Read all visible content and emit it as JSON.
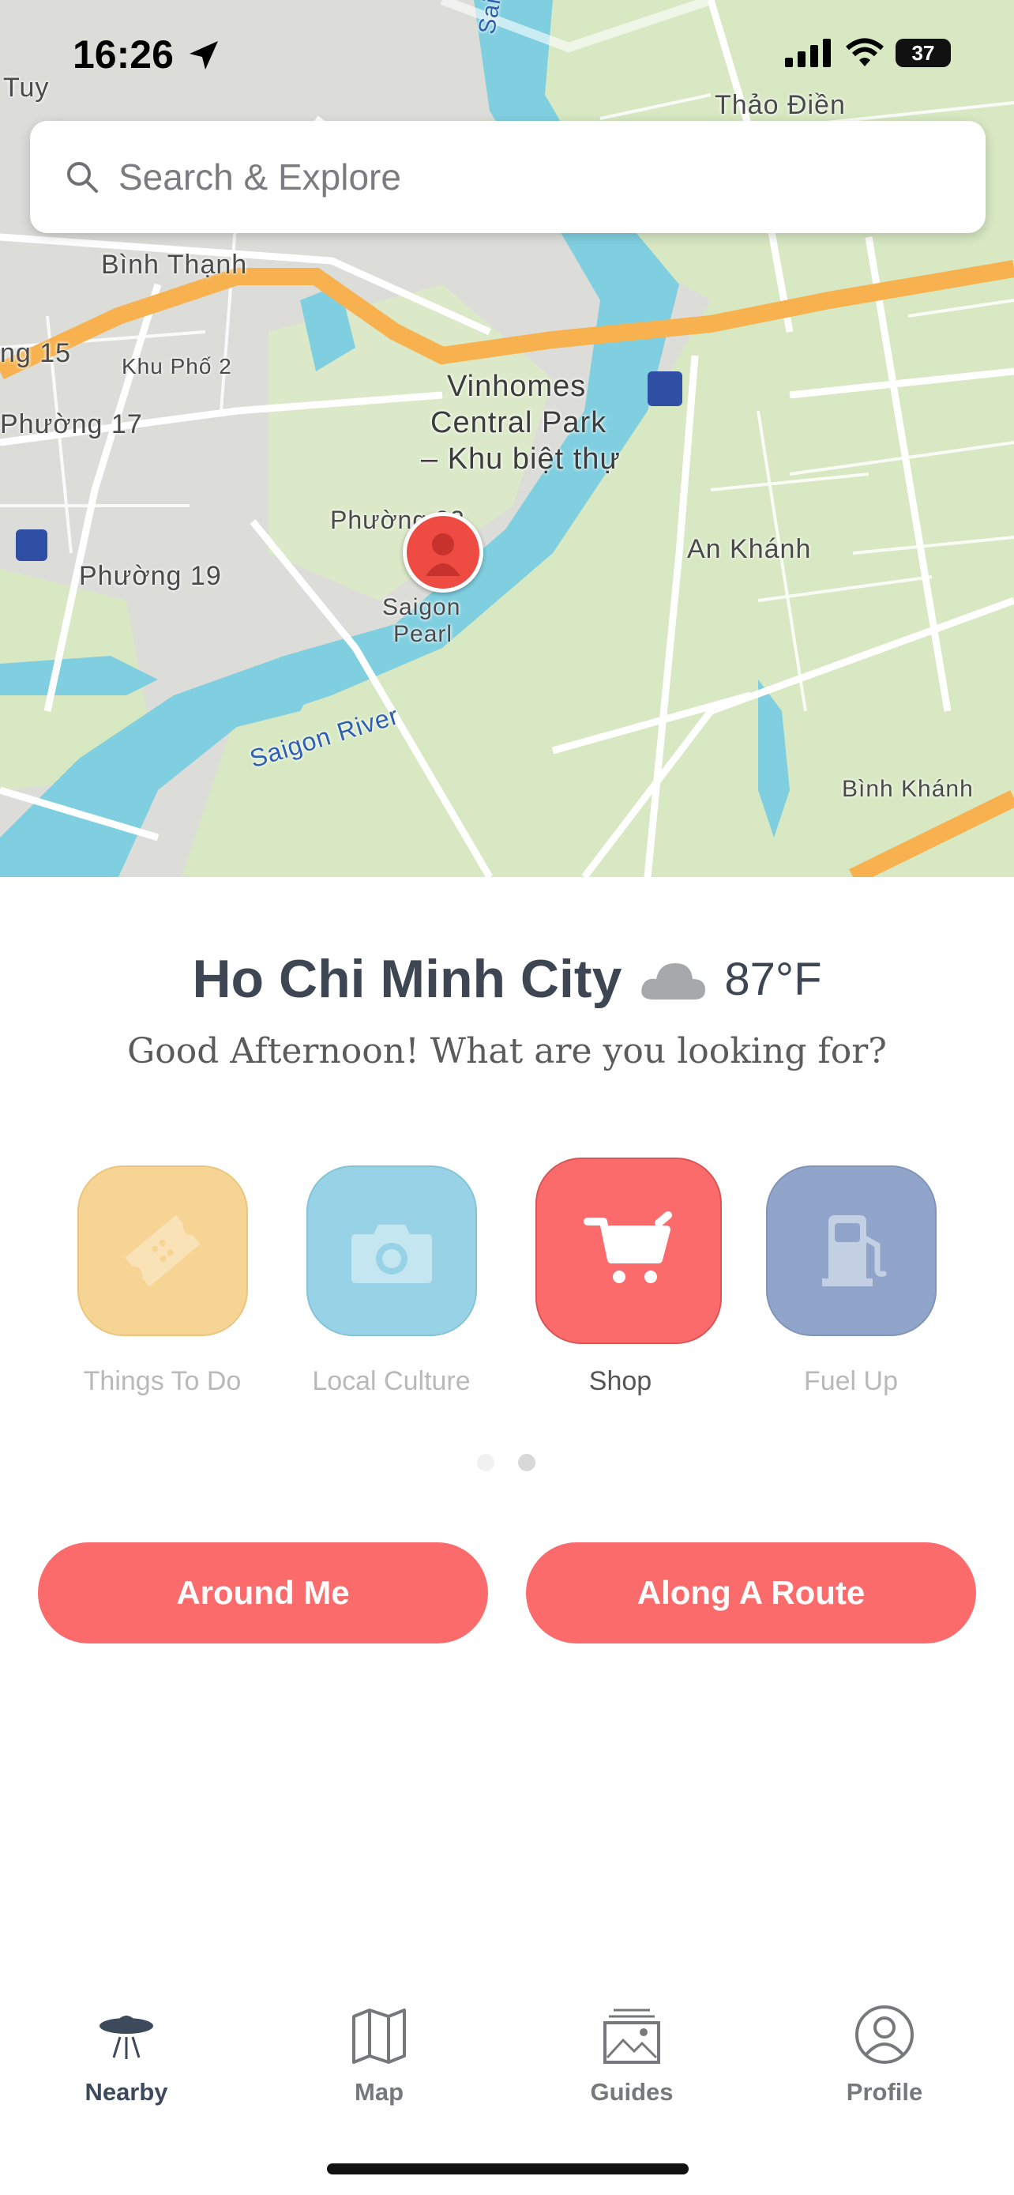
{
  "status_bar": {
    "time": "16:26",
    "battery": "37"
  },
  "search": {
    "placeholder": "Search & Explore"
  },
  "map": {
    "labels": {
      "thao_dien": "Thảo Điền",
      "binh_thanh": "Bình Thạnh",
      "ng15": "ng 15",
      "khu_pho_2": "Khu Phố 2",
      "phuong17": "Phường 17",
      "phuong19": "Phường 19",
      "vinhomes": "Vinhomes",
      "central_park": "Central Park",
      "khu_biet_thu": "– Khu biệt thự",
      "phuong22": "Phường 22",
      "saigon_pearl_1": "Saigon",
      "saigon_pearl_2": "Pearl",
      "an_khanh": "An Khánh",
      "binh_khanh": "Bình Khánh",
      "saigon_river": "Saigon River",
      "saigon_r_top": "Saigon R",
      "tuy": "Tuy"
    }
  },
  "location": {
    "city": "Ho Chi Minh City",
    "temperature": "87°F",
    "weather_icon": "cloud-icon"
  },
  "greeting": "Good Afternoon! What are you looking for?",
  "categories": [
    {
      "label": "Things To Do",
      "icon": "ticket-icon",
      "color": "#f6d494"
    },
    {
      "label": "Local Culture",
      "icon": "camera-icon",
      "color": "#97d2e6"
    },
    {
      "label": "Shop",
      "icon": "cart-icon",
      "color": "#fb6b6c",
      "selected": true
    },
    {
      "label": "Fuel Up",
      "icon": "fuel-pump-icon",
      "color": "#90a5c9"
    }
  ],
  "pager": {
    "pages": 2,
    "current": 2
  },
  "actions": {
    "around_me": "Around Me",
    "along_route": "Along A Route"
  },
  "tabs": [
    {
      "label": "Nearby",
      "icon": "ufo-icon",
      "active": true
    },
    {
      "label": "Map",
      "icon": "map-icon"
    },
    {
      "label": "Guides",
      "icon": "guides-icon"
    },
    {
      "label": "Profile",
      "icon": "profile-icon"
    }
  ],
  "colors": {
    "accent": "#fb6b6c",
    "text_dark": "#3d4652",
    "river": "#7fcfe0",
    "park": "#d3e8b9",
    "road_major": "#f7b24f"
  }
}
